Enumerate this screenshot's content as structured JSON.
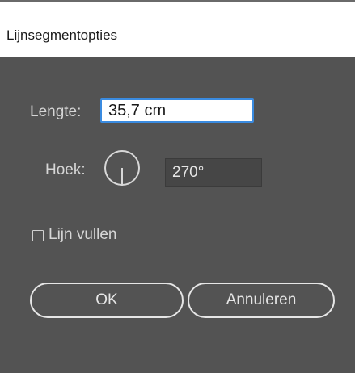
{
  "window": {
    "title": "Lijnsegmentopties"
  },
  "length": {
    "label": "Lengte:",
    "value": "35,7 cm"
  },
  "angle": {
    "label": "Hoek:",
    "value": "270°"
  },
  "fill_line": {
    "label": "Lijn vullen",
    "checked": false
  },
  "buttons": {
    "ok": "OK",
    "cancel": "Annuleren"
  },
  "colors": {
    "panel": "#535353",
    "accent": "#3a8be0"
  }
}
